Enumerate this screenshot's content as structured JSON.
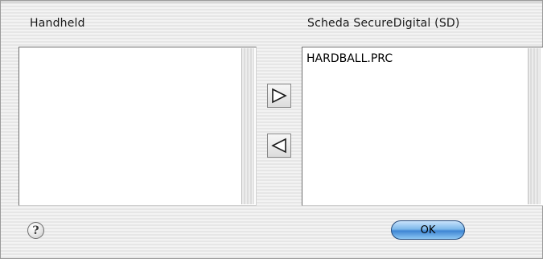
{
  "dialog": {
    "left_title": "Handheld",
    "right_title": "Scheda SecureDigital (SD)",
    "left_items": [],
    "right_items": [
      "HARDBALL.PRC"
    ],
    "ok_label": "OK",
    "help_glyph": "?"
  }
}
